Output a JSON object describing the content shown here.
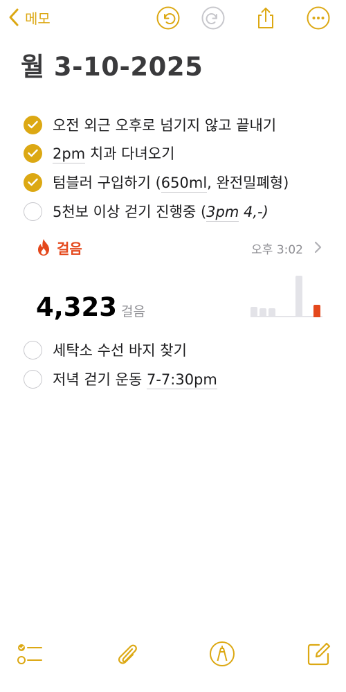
{
  "nav": {
    "back_label": "메모"
  },
  "toolbar": {
    "undo_icon": "undo-icon",
    "redo_icon": "redo-icon",
    "share_icon": "share-icon",
    "more_icon": "more-icon"
  },
  "note": {
    "title": "월 3-10-2025",
    "checklist_top": [
      {
        "text": "오전 외근 오후로 넘기지 않고 끝내기",
        "done": true
      },
      {
        "pre": "",
        "ul": "2pm",
        "post": " 치과 다녀오기",
        "done": true
      },
      {
        "pre": "텀블러 구입하기 (",
        "ul": "650ml",
        "post": ", 완전밀폐형)",
        "done": true
      },
      {
        "pre": "5천보 이상 걷기 진행중 (",
        "ul": "3pm",
        "post": " 4,-)",
        "done": false
      }
    ],
    "activity": {
      "title": "걸음",
      "time": "오후 3:02",
      "value": "4,323",
      "unit": "걸음",
      "accent": "#e4481c",
      "bars": [
        0.25,
        0.22,
        0.21,
        0,
        0,
        1.0,
        0.03,
        0.3
      ]
    },
    "checklist_bottom": [
      {
        "text": "세탁소 수선 바지 찾기",
        "done": false
      },
      {
        "pre": "저녁 걷기 운동 ",
        "ul": "7-7:30pm",
        "post": "",
        "done": false
      }
    ]
  },
  "bottom_toolbar": {
    "checklist_icon": "checklist-icon",
    "attachment_icon": "paperclip-icon",
    "markup_icon": "pen-markup-icon",
    "compose_icon": "compose-icon"
  },
  "colors": {
    "accent": "#dca813",
    "activity": "#e4481c"
  }
}
